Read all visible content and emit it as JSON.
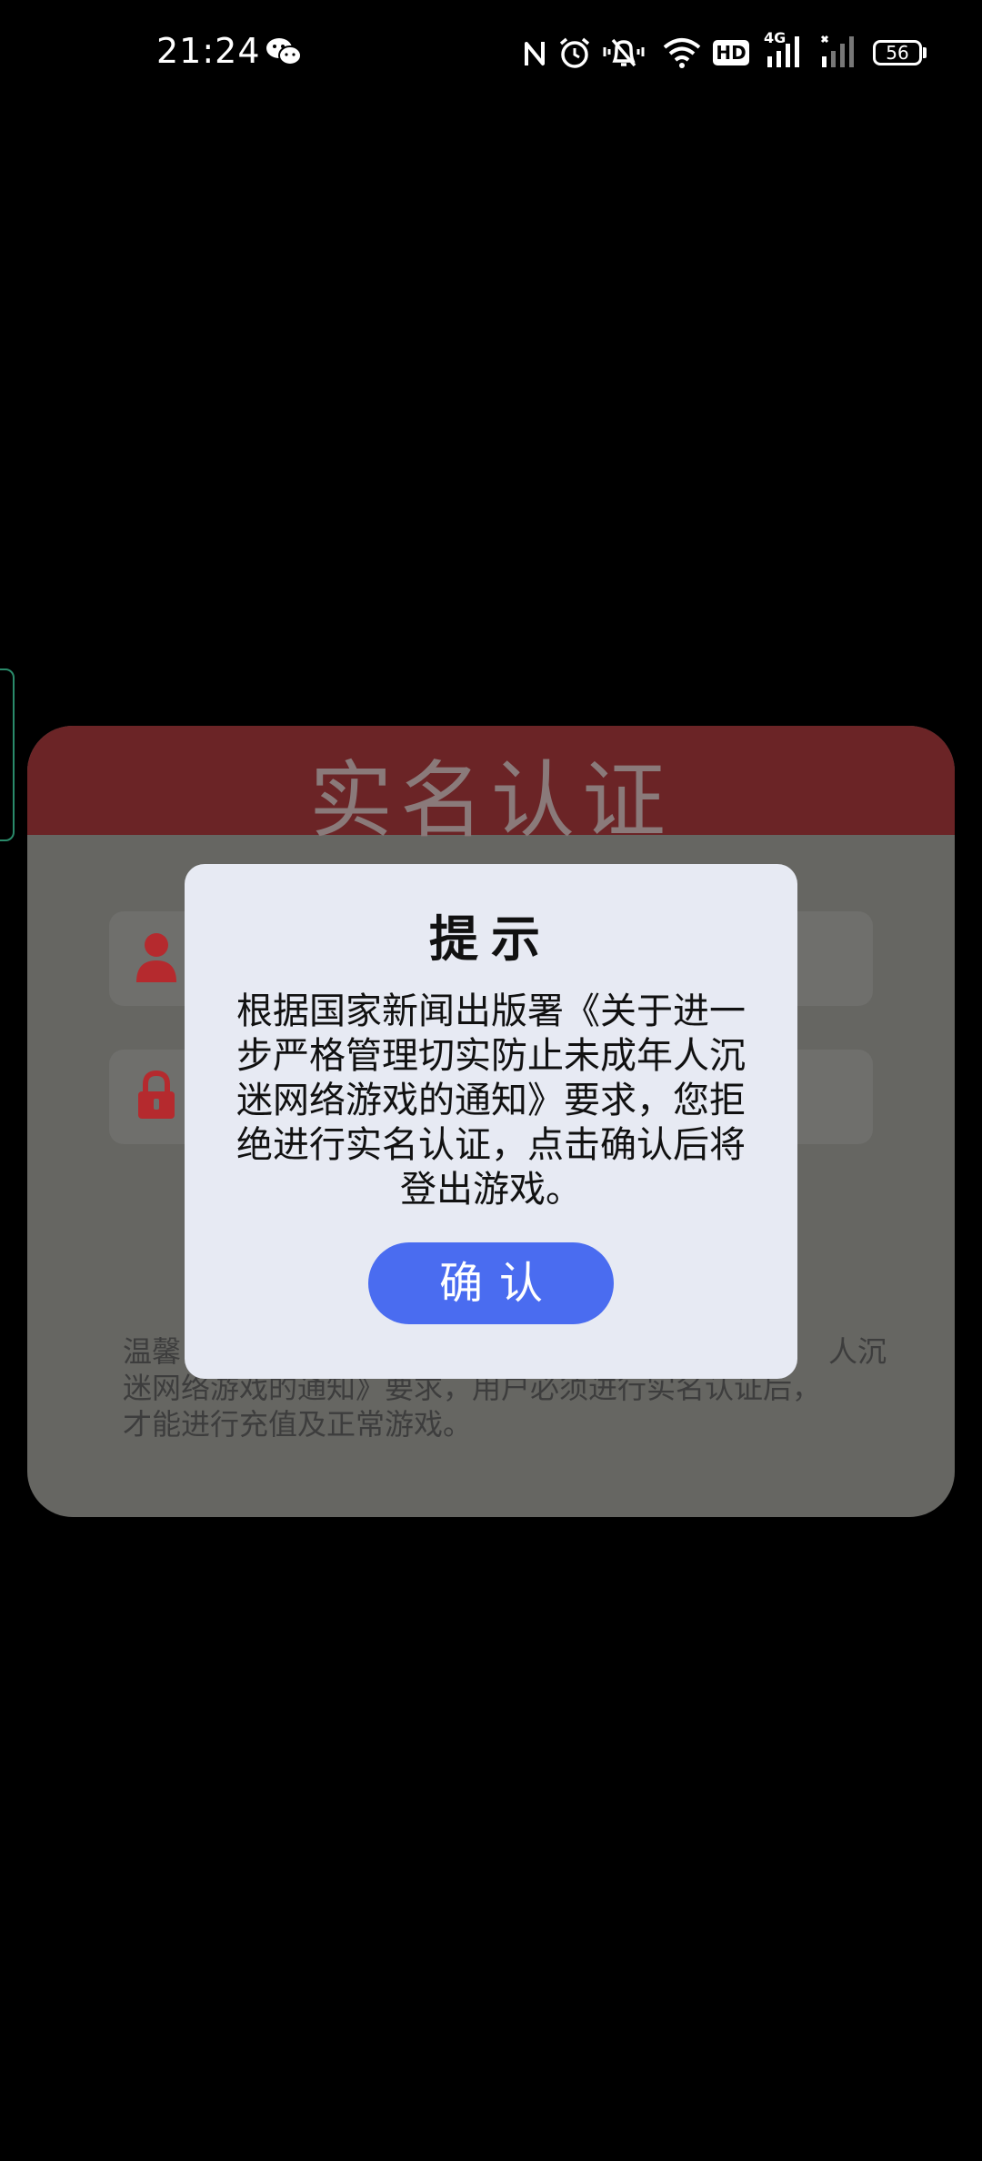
{
  "status_bar": {
    "time": "21:24",
    "battery_level": "56",
    "network_type": "4G",
    "hd_label": "HD",
    "icons": [
      "wechat-icon",
      "nfc-icon",
      "alarm-icon",
      "silent-bell-icon",
      "wifi-icon",
      "hd-icon",
      "signal-4g-icon",
      "signal-2-icon",
      "battery-icon"
    ]
  },
  "verify_card": {
    "title": "实名认证",
    "fields": [
      {
        "icon": "user-icon"
      },
      {
        "icon": "lock-icon"
      }
    ],
    "notice_visible_text": "温馨                                                                      人沉\n迷网络游戏的通知》要求，用户必须进行实名认证后，\n才能进行充值及正常游戏。",
    "header_color": "#6b2426"
  },
  "dialog": {
    "title": "提示",
    "message": "根据国家新闻出版署《关于进一步严格管理切实防止未成年人沉迷网络游戏的通知》要求，您拒绝进行实名认证，点击确认后将登出游戏。",
    "confirm_label": "确认",
    "button_color": "#4a6cf0"
  }
}
